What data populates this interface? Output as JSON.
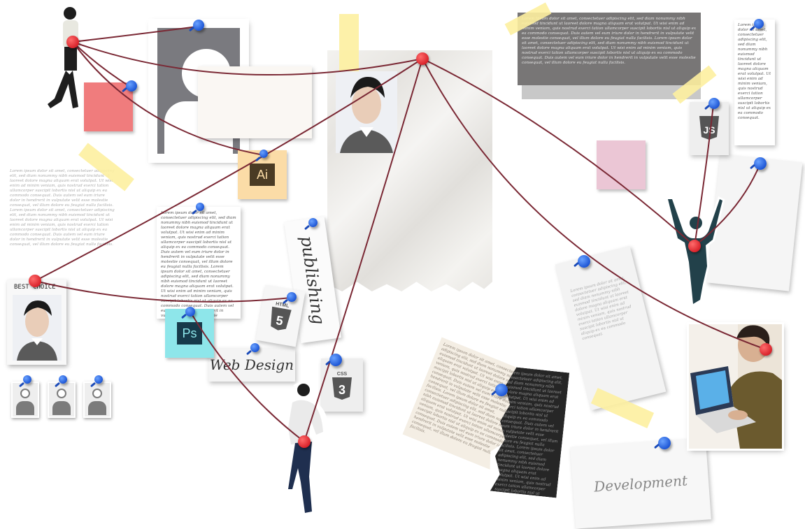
{
  "board": {
    "colors": {
      "string": "#7a2834",
      "pin_blue": "#2563eb",
      "pin_red": "#d9232b",
      "tape": "#fdf0a0"
    }
  },
  "labels": {
    "publishing": "publishing",
    "web_design": "Web Design",
    "development": "Development",
    "best_choice": "BEST CHOICE"
  },
  "badges": {
    "illustrator": "Ai",
    "photoshop": "Ps",
    "html5": "HTML",
    "html5_num": "5",
    "css3": "CSS",
    "css3_num": "3",
    "js": "JS"
  },
  "notes": {
    "lorem_short": "Lorem ipsum dolor sit amet, consectetuer adipiscing elit, sed diam nonummy nibh euismod tincidunt ut laoreet dolore magna aliquam erat volutpat. Ut wisi enim ad minim veniam, quis nostrud exerci tation ullamcorper suscipit lobortis nisl ut aliquip ex ea commodo consequat.",
    "lorem_long": "Lorem ipsum dolor sit amet, consectetuer adipiscing elit, sed diam nonummy nibh euismod tincidunt ut laoreet dolore magna aliquam erat volutpat. Ut wisi enim ad minim veniam, quis nostrud exerci tation ullamcorper suscipit lobortis nisl ut aliquip ex ea commodo consequat. Duis autem vel eum iriure dolor in hendrerit in vulputate velit esse molestie consequat, vel illum dolore eu feugiat nulla facilisis. Lorem ipsum dolor sit amet, consectetuer adipiscing elit, sed diam nonummy nibh euismod tincidunt ut laoreet dolore magna aliquam erat volutpat. Ut wisi enim ad minim veniam, quis nostrud exerci tation ullamcorper suscipit lobortis nisl ut aliquip ex ea commodo consequat. Duis autem vel eum iriure dolor in hendrerit in vulputate velit esse molestie consequat, vel illum dolore eu feugiat nulla facilisis."
  },
  "icons": {
    "portrait_large": "portrait-photo",
    "portrait_small": "portrait-photo",
    "profile_placeholder": "user-placeholder-icon",
    "walker": "walking-person-cutout",
    "dancer": "dancer-cutout",
    "runner": "running-person-cutout",
    "laptop_user": "laptop-user-photo"
  }
}
